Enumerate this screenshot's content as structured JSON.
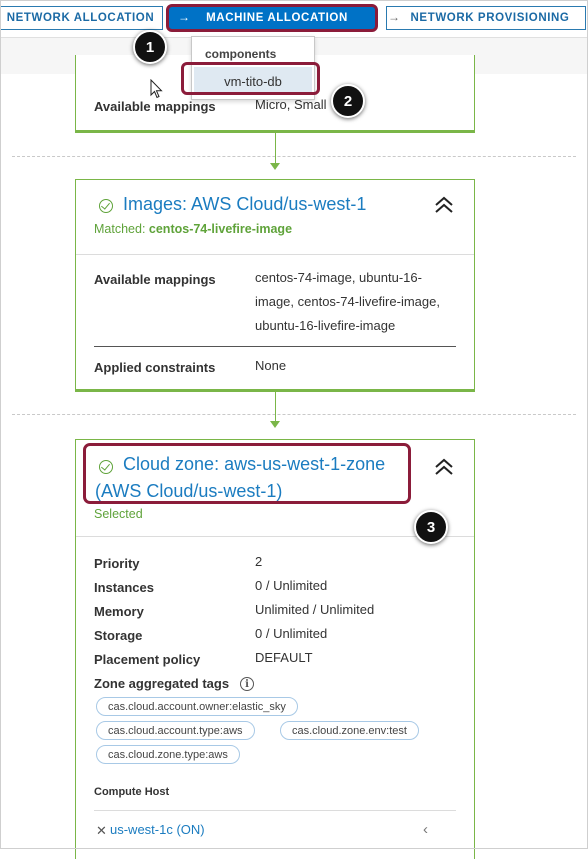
{
  "tabs": {
    "network_allocation": "NETWORK ALLOCATION",
    "machine_allocation": "MACHINE ALLOCATION",
    "network_provisioning": "NETWORK PROVISIONING"
  },
  "dropdown": {
    "label": "components",
    "selected_item": "vm-tito-db"
  },
  "steps": [
    "1",
    "2",
    "3"
  ],
  "card_top": {
    "key": "Available mappings",
    "value": "Micro, Small"
  },
  "images_card": {
    "title": "Images: AWS Cloud/us-west-1",
    "matched_prefix": "Matched:",
    "matched_value": "centos-74-livefire-image",
    "available_mappings_label": "Available mappings",
    "available_mappings_lines": [
      "centos-74-image, ubuntu-16-",
      "image, centos-74-livefire-image,",
      "ubuntu-16-livefire-image"
    ],
    "applied_constraints_label": "Applied constraints",
    "applied_constraints_value": "None"
  },
  "cloud_zone_card": {
    "title_line1": "Cloud zone: aws-us-west-1-zone",
    "title_line2": "(AWS Cloud/us-west-1)",
    "status": "Selected",
    "properties": [
      {
        "key": "Priority",
        "value": "2"
      },
      {
        "key": "Instances",
        "value": "0 / Unlimited"
      },
      {
        "key": "Memory",
        "value": "Unlimited / Unlimited"
      },
      {
        "key": "Storage",
        "value": "0 / Unlimited"
      },
      {
        "key": "Placement policy",
        "value": "DEFAULT"
      }
    ],
    "tags_label": "Zone aggregated tags",
    "tags": [
      "cas.cloud.account.owner:elastic_sky",
      "cas.cloud.account.type:aws",
      "cas.cloud.zone.env:test",
      "cas.cloud.zone.type:aws"
    ],
    "compute_host_label": "Compute Host",
    "compute_host": "us-west-1c (ON)"
  },
  "colors": {
    "accent": "#0072c6",
    "success": "#5fa33a",
    "highlight": "#8b1c3a",
    "link": "#1b7cc0"
  }
}
